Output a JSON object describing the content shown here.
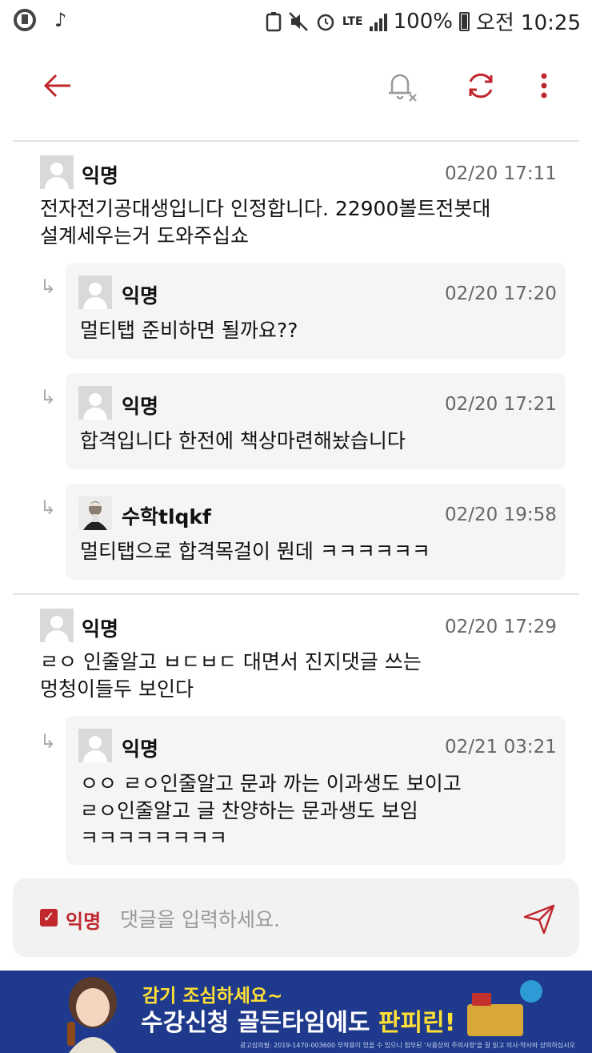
{
  "status_bar": {
    "battery": "100%",
    "time": "오전 10:25",
    "network": "LTE"
  },
  "comments": [
    {
      "author": "익명",
      "time": "02/20 17:11",
      "text_lines": [
        "전자전기공대생입니다 인정합니다. 22900볼트전봇대",
        "설계세우는거 도와주십쇼"
      ],
      "replies": [
        {
          "author": "익명",
          "time": "02/20 17:20",
          "text_lines": [
            "멀티탭 준비하면 될까요??"
          ]
        },
        {
          "author": "익명",
          "time": "02/20 17:21",
          "text_lines": [
            "합격입니다 한전에 책상마련해놨습니다"
          ]
        },
        {
          "author": "수학tlqkf",
          "time": "02/20 19:58",
          "text_lines": [
            "멀티탭으로 합격목걸이 뭔데 ㅋㅋㅋㅋㅋㅋ"
          ]
        }
      ]
    },
    {
      "author": "익명",
      "time": "02/20 17:29",
      "text_lines": [
        "ㄹㅇ 인줄알고 ㅂㄷㅂㄷ 대면서 진지댓글 쓰는",
        "멍청이들두 보인다"
      ],
      "replies": [
        {
          "author": "익명",
          "time": "02/21 03:21",
          "text_lines": [
            "ㅇㅇ ㄹㅇ인줄알고 문과 까는 이과생도 보이고",
            "ㄹㅇ인줄알고 글 찬양하는 문과생도 보임",
            "ㅋㅋㅋㅋㅋㅋㅋㅋ"
          ]
        }
      ]
    }
  ],
  "input_bar": {
    "anonymous_label": "익명",
    "anonymous_checked": true,
    "placeholder": "댓글을 입력하세요."
  },
  "ad": {
    "line1": "감기 조심하세요~",
    "line2_prefix": "수강신청 골든타임에도 ",
    "line2_highlight": "판피린!",
    "fine_print": "광고심의필: 2019-1470-003600   부작용이 있을 수 있으니 첨부된 '사용상의 주의사항'을 잘 읽고 의사·약사와 상의하십시오"
  },
  "colors": {
    "accent": "#c0272d",
    "ad_bg": "#1f3a8c",
    "ad_highlight": "#ffe034",
    "reply_bg": "#f5f5f5"
  }
}
